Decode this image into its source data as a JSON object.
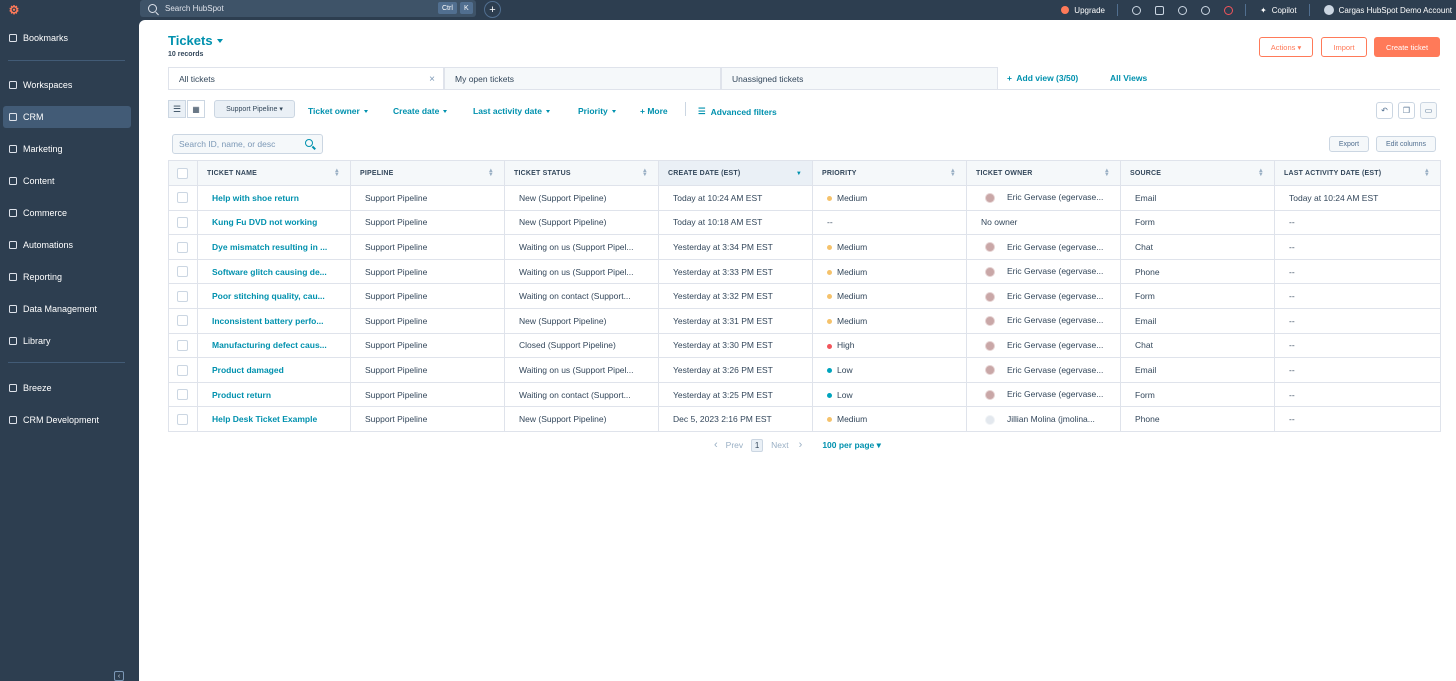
{
  "topbar": {
    "search_placeholder": "Search HubSpot",
    "shortcut_ctrl": "Ctrl",
    "shortcut_k": "K",
    "upgrade": "Upgrade",
    "copilot": "Copilot",
    "account": "Cargas HubSpot Demo Account"
  },
  "sidebar": {
    "items": [
      {
        "label": "Bookmarks",
        "icon": "bookmark-icon"
      },
      {
        "label": "Workspaces",
        "icon": "workspaces-icon"
      },
      {
        "label": "CRM",
        "icon": "crm-icon",
        "active": true
      },
      {
        "label": "Marketing",
        "icon": "marketing-icon"
      },
      {
        "label": "Content",
        "icon": "content-icon"
      },
      {
        "label": "Commerce",
        "icon": "commerce-icon"
      },
      {
        "label": "Automations",
        "icon": "automations-icon"
      },
      {
        "label": "Reporting",
        "icon": "reporting-icon"
      },
      {
        "label": "Data Management",
        "icon": "data-management-icon"
      },
      {
        "label": "Library",
        "icon": "library-icon"
      },
      {
        "label": "Breeze",
        "icon": "breeze-icon"
      },
      {
        "label": "CRM Development",
        "icon": "crm-development-icon"
      }
    ]
  },
  "header": {
    "title": "Tickets",
    "records": "10 records",
    "actions": "Actions",
    "import": "Import",
    "create": "Create ticket"
  },
  "views": {
    "tabs": [
      "All tickets",
      "My open tickets",
      "Unassigned tickets"
    ],
    "add_view": "Add view (3/50)",
    "all_views": "All Views"
  },
  "filters": {
    "pipeline": "Support Pipeline",
    "owner": "Ticket owner",
    "create_date": "Create date",
    "last_activity": "Last activity date",
    "priority": "Priority",
    "more": "More",
    "advanced": "Advanced filters"
  },
  "table": {
    "search_placeholder": "Search ID, name, or desc",
    "export": "Export",
    "edit_columns": "Edit columns",
    "columns": [
      "Ticket name",
      "Pipeline",
      "Ticket status",
      "Create date (EST)",
      "Priority",
      "Ticket owner",
      "Source",
      "Last activity date (EST)"
    ],
    "rows": [
      {
        "name": "Help with shoe return",
        "pipeline": "Support Pipeline",
        "status": "New (Support Pipeline)",
        "created": "Today at 10:24 AM EST",
        "priority": "Medium",
        "owner": "Eric Gervase (egervase...",
        "source": "Email",
        "activity": "Today at 10:24 AM EST"
      },
      {
        "name": "Kung Fu DVD not working",
        "pipeline": "Support Pipeline",
        "status": "New (Support Pipeline)",
        "created": "Today at 10:18 AM EST",
        "priority": "--",
        "owner": "No owner",
        "source": "Form",
        "activity": "--"
      },
      {
        "name": "Dye mismatch resulting in ...",
        "pipeline": "Support Pipeline",
        "status": "Waiting on us (Support Pipel...",
        "created": "Yesterday at 3:34 PM EST",
        "priority": "Medium",
        "owner": "Eric Gervase (egervase...",
        "source": "Chat",
        "activity": "--"
      },
      {
        "name": "Software glitch causing de...",
        "pipeline": "Support Pipeline",
        "status": "Waiting on us (Support Pipel...",
        "created": "Yesterday at 3:33 PM EST",
        "priority": "Medium",
        "owner": "Eric Gervase (egervase...",
        "source": "Phone",
        "activity": "--"
      },
      {
        "name": "Poor stitching quality, cau...",
        "pipeline": "Support Pipeline",
        "status": "Waiting on contact (Support...",
        "created": "Yesterday at 3:32 PM EST",
        "priority": "Medium",
        "owner": "Eric Gervase (egervase...",
        "source": "Form",
        "activity": "--"
      },
      {
        "name": "Inconsistent battery perfo...",
        "pipeline": "Support Pipeline",
        "status": "New (Support Pipeline)",
        "created": "Yesterday at 3:31 PM EST",
        "priority": "Medium",
        "owner": "Eric Gervase (egervase...",
        "source": "Email",
        "activity": "--"
      },
      {
        "name": "Manufacturing defect caus...",
        "pipeline": "Support Pipeline",
        "status": "Closed (Support Pipeline)",
        "created": "Yesterday at 3:30 PM EST",
        "priority": "High",
        "owner": "Eric Gervase (egervase...",
        "source": "Chat",
        "activity": "--"
      },
      {
        "name": "Product damaged",
        "pipeline": "Support Pipeline",
        "status": "Waiting on us (Support Pipel...",
        "created": "Yesterday at 3:26 PM EST",
        "priority": "Low",
        "owner": "Eric Gervase (egervase...",
        "source": "Email",
        "activity": "--"
      },
      {
        "name": "Product return",
        "pipeline": "Support Pipeline",
        "status": "Waiting on contact (Support...",
        "created": "Yesterday at 3:25 PM EST",
        "priority": "Low",
        "owner": "Eric Gervase (egervase...",
        "source": "Form",
        "activity": "--"
      },
      {
        "name": "Help Desk Ticket Example",
        "pipeline": "Support Pipeline",
        "status": "New (Support Pipeline)",
        "created": "Dec 5, 2023 2:16 PM EST",
        "priority": "Medium",
        "owner": "Jillian Molina (jmolina...",
        "source": "Phone",
        "activity": "--"
      }
    ]
  },
  "priority_colors": {
    "Medium": "#f5c26b",
    "High": "#f2545b",
    "Low": "#00a4bd"
  },
  "pager": {
    "prev": "Prev",
    "page": "1",
    "next": "Next",
    "per_page": "100 per page"
  }
}
